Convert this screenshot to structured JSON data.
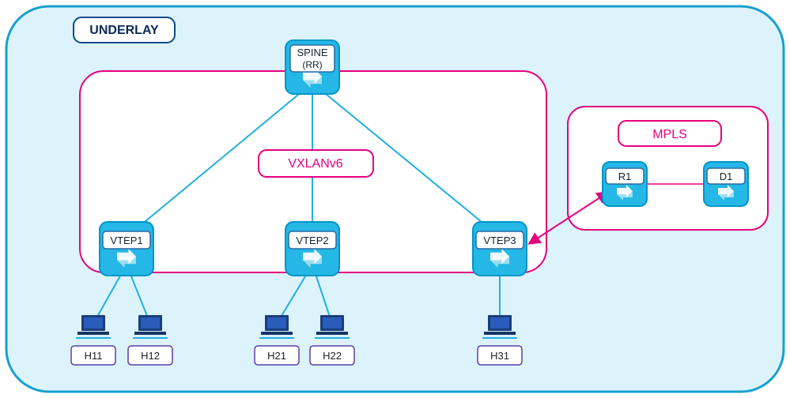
{
  "diagram": {
    "title": "UNDERLAY",
    "fabric": {
      "label": "VXLANv6",
      "spine": {
        "name": "SPINE",
        "sub": "(RR)"
      },
      "vtep1": {
        "name": "VTEP1"
      },
      "vtep2": {
        "name": "VTEP2"
      },
      "vtep3": {
        "name": "VTEP3"
      }
    },
    "hosts": {
      "h11": "H11",
      "h12": "H12",
      "h21": "H21",
      "h22": "H22",
      "h31": "H31"
    },
    "mpls": {
      "label": "MPLS",
      "r1": "R1",
      "d1": "D1"
    },
    "colors": {
      "bg": "#ddf3fb",
      "node": "#25b7e5",
      "nodeDk": "#0096c8",
      "border": "#15a0d0",
      "magenta": "#e6007e",
      "hostDk": "#004a99",
      "hostLt": "#3a6fd8",
      "white": "#ffffff"
    }
  }
}
